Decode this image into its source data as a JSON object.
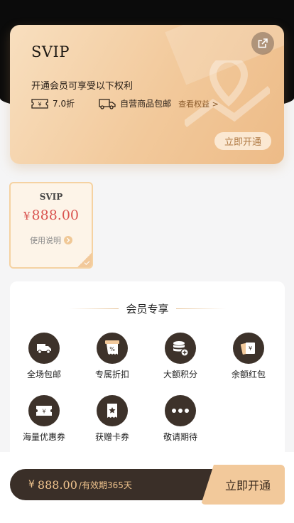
{
  "svip_card": {
    "title": "SVIP",
    "description": "开通会员可享受以下权利",
    "perks": [
      {
        "label": "7.0折",
        "icon": "ticket-icon"
      },
      {
        "label": "自营商品包邮",
        "icon": "truck-icon"
      }
    ],
    "view_rights": "查看权益 >",
    "open_button": "立即开通"
  },
  "plan": {
    "name": "SVIP",
    "currency": "¥",
    "price": "888.00",
    "usage": "使用说明"
  },
  "exclusive": {
    "title": "会员专享",
    "items": [
      {
        "label": "全场包邮",
        "icon": "truck-icon"
      },
      {
        "label": "专属折扣",
        "icon": "discount-icon"
      },
      {
        "label": "大额积分",
        "icon": "coins-icon"
      },
      {
        "label": "余额红包",
        "icon": "red-envelope-icon"
      },
      {
        "label": "海量优惠券",
        "icon": "coupon-icon"
      },
      {
        "label": "获赠卡券",
        "icon": "gift-card-icon"
      },
      {
        "label": "敬请期待",
        "icon": "more-icon"
      }
    ]
  },
  "bottom_bar": {
    "currency": "¥",
    "price": "888.00",
    "period": "/有效期365天",
    "open_button": "立即开通"
  },
  "colors": {
    "gold": "#f2c99b",
    "dark": "#3d322a",
    "price_red": "#d9534f"
  }
}
